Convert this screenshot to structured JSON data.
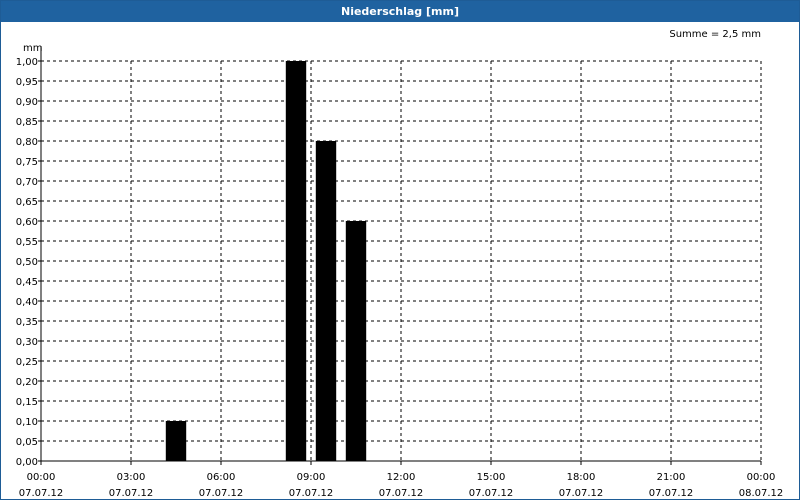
{
  "window": {
    "title": "Niederschlag [mm]"
  },
  "chart_data": {
    "type": "bar",
    "title": "Niederschlag [mm]",
    "sum_label": "Summe = 2,5 mm",
    "ylabel": "mm",
    "ylim": [
      0,
      1.0
    ],
    "yticks": [
      "0,00",
      "0,05",
      "0,10",
      "0,15",
      "0,20",
      "0,25",
      "0,30",
      "0,35",
      "0,40",
      "0,45",
      "0,50",
      "0,55",
      "0,60",
      "0,65",
      "0,70",
      "0,75",
      "0,80",
      "0,85",
      "0,90",
      "0,95",
      "1,00"
    ],
    "xlim": [
      "2012-07-07 00:00",
      "2012-07-08 00:00"
    ],
    "xticks": [
      {
        "time": "00:00",
        "date": "07.07.12"
      },
      {
        "time": "03:00",
        "date": "07.07.12"
      },
      {
        "time": "06:00",
        "date": "07.07.12"
      },
      {
        "time": "09:00",
        "date": "07.07.12"
      },
      {
        "time": "12:00",
        "date": "07.07.12"
      },
      {
        "time": "15:00",
        "date": "07.07.12"
      },
      {
        "time": "18:00",
        "date": "07.07.12"
      },
      {
        "time": "21:00",
        "date": "07.07.12"
      },
      {
        "time": "00:00",
        "date": "08.07.12"
      }
    ],
    "bars": [
      {
        "start": "04:00",
        "end": "05:00",
        "value": 0.1
      },
      {
        "start": "08:00",
        "end": "09:00",
        "value": 1.0
      },
      {
        "start": "09:00",
        "end": "10:00",
        "value": 0.8
      },
      {
        "start": "10:00",
        "end": "11:00",
        "value": 0.6
      }
    ],
    "grid": true,
    "colors": {
      "bar": "#000000",
      "titlebar": "#1f62a0",
      "grid": "#000000"
    }
  }
}
